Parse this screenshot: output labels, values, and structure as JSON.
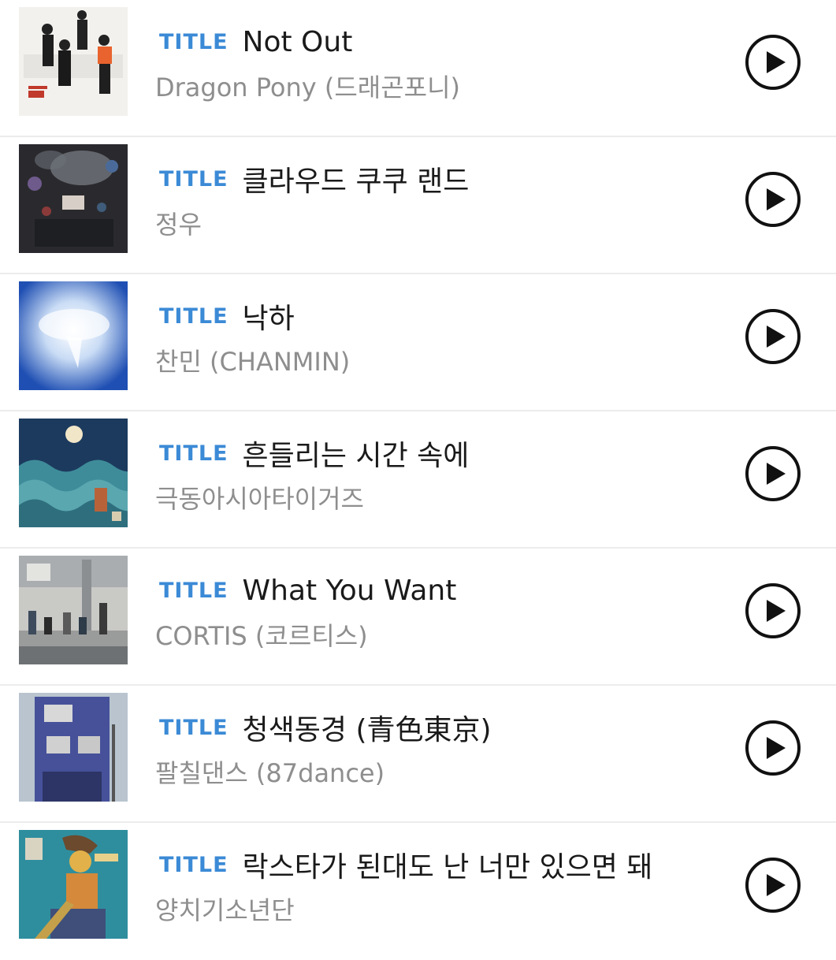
{
  "badge_label": "TITLE",
  "tracks": [
    {
      "title": "Not Out",
      "artist": "Dragon Pony (드래곤포니)"
    },
    {
      "title": "클라우드 쿠쿠 랜드",
      "artist": "정우"
    },
    {
      "title": "낙하",
      "artist": "찬민 (CHANMIN)"
    },
    {
      "title": "흔들리는 시간 속에",
      "artist": "극동아시아타이거즈"
    },
    {
      "title": "What You Want",
      "artist": "CORTIS (코르티스)"
    },
    {
      "title": "청색동경 (青色東京)",
      "artist": "팔칠댄스 (87dance)"
    },
    {
      "title": "락스타가 된대도 난 너만 있으면 돼",
      "artist": "양치기소년단"
    }
  ],
  "colors": {
    "badge": "#3b8ad6",
    "title": "#1a1a1a",
    "artist": "#8e8e8e",
    "divider": "#ececec"
  },
  "icons": {
    "play": "play-circle-icon"
  }
}
